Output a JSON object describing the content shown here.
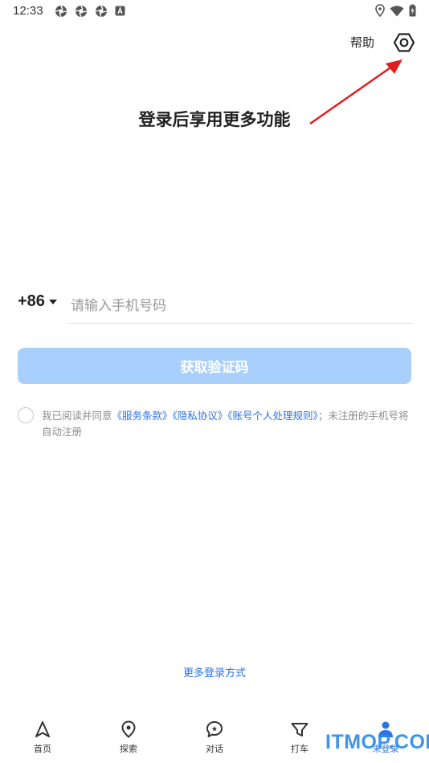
{
  "status_bar": {
    "time": "12:33",
    "notifications": [
      "aperture-icon",
      "aperture-icon",
      "aperture-icon",
      "a-badge-icon"
    ],
    "right_icons": [
      "location-icon",
      "wifi-icon",
      "battery-charging-icon"
    ]
  },
  "header": {
    "help_label": "帮助",
    "settings_icon": "settings-hexagon-icon"
  },
  "title": "登录后享用更多功能",
  "phone": {
    "country_code": "+86",
    "placeholder": "请输入手机号码",
    "value": ""
  },
  "get_code_button": "获取验证码",
  "agreement": {
    "checked": false,
    "prefix": "我已阅读并同意",
    "terms": "《服务条款》",
    "privacy": "《隐私协议》",
    "personal": "《账号个人处理规则》",
    "suffix": "；未注册的手机号将自动注册"
  },
  "more_login": "更多登录方式",
  "nav": {
    "items": [
      {
        "label": "首页",
        "icon": "navigation-arrow-icon"
      },
      {
        "label": "探索",
        "icon": "location-pin-icon"
      },
      {
        "label": "对话",
        "icon": "chat-bubble-icon"
      },
      {
        "label": "打车",
        "icon": "taxi-icon"
      },
      {
        "label": "未登录",
        "icon": "user-icon"
      }
    ]
  },
  "watermark": "ITMOP.COM",
  "colors": {
    "accent": "#2c73e6",
    "button_disabled": "#a9d0fc",
    "annotation_arrow": "#e02020"
  }
}
